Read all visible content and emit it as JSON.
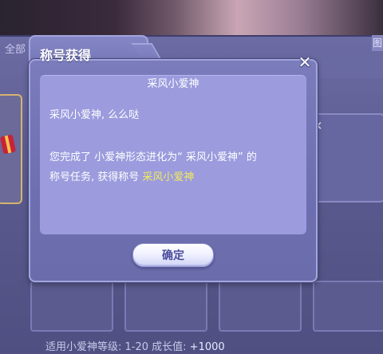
{
  "background": {
    "tab_label": "全部",
    "right_tab_char": "图",
    "footer_level_text": "适用小爱神等级: 1-20 成长值: ",
    "footer_growth_value": "+1000"
  },
  "dialog": {
    "title": "称号获得",
    "close_icon": "close-icon",
    "header": "采风小爱神",
    "greeting": "采风小爱神, 么么哒",
    "body_line1": "您完成了 小爱神形态进化为“ 采风小爱神” 的",
    "body_line2_prefix": "称号任务, 获得称号 ",
    "title_earned": "采风小爱神",
    "confirm_label": "确定"
  },
  "colors": {
    "panel": "#6d6fb0",
    "content": "#9b9bde",
    "highlight": "#f1ea5e",
    "button_text": "#4a4c9c"
  }
}
